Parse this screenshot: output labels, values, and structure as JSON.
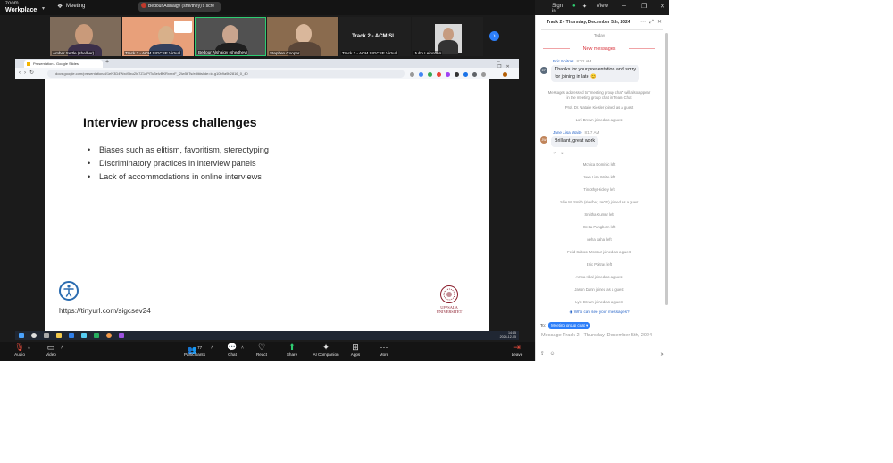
{
  "app": {
    "brand_line1": "zoom",
    "brand_line2": "Workplace",
    "meeting_label": "Meeting",
    "speaking_now": "Bedour Alshaigy (she/they)'s scre",
    "sign_in": "Sign in",
    "view_label": "View"
  },
  "participants": [
    {
      "name": "Amber Settle (she/her)"
    },
    {
      "name": "Track 2 - ACM SIGCSE Virtual"
    },
    {
      "name": "Bedour Alshaigy (she/they)"
    },
    {
      "name": "Stephen Cooper"
    },
    {
      "name": "Track 2 - ACM SIGCSE Virtual",
      "center_label": "Track 2 - ACM SI..."
    },
    {
      "name": "Juho Leinonen"
    }
  ],
  "browser": {
    "tab_title": "Presentation - Google Slides",
    "url": "docs.google.com/presentation/d/1eN3D4Wxd9lxu2ln7Z1oPlTu3elvBXRxmxF_l2lw5bTs/edit#slide=id.g10b9a9b2816_0_40"
  },
  "slide": {
    "title": "Interview process challenges",
    "bullets": [
      "Biases such as elitism, favoritism, stereotyping",
      "Discriminatory practices in interview panels",
      "Lack of accommodations in online interviews"
    ],
    "link": "https://tinyurl.com/sigcsev24",
    "logo_line1": "UPPSALA",
    "logo_line2": "UNIVERSITET"
  },
  "taskbar": {
    "time": "14:45",
    "date": "2024-12-05"
  },
  "toolbar": {
    "audio": "Audio",
    "video": "Video",
    "participants": "Participants",
    "participants_count": "77",
    "chat": "Chat",
    "react": "React",
    "share": "Share",
    "ai_companion": "AI Companion",
    "apps": "Apps",
    "more": "More",
    "leave": "Leave"
  },
  "chat": {
    "title": "Track 2 - Thursday, December 5th, 2024",
    "today": "Today",
    "new_messages": "New messages",
    "messages": [
      {
        "sender": "Eric Poitras",
        "time": "8:02 AM",
        "text_line1": "Thanks for your presentation and sorry",
        "text_line2": "for joining in late 😊",
        "initials": "EP"
      },
      {
        "sender": "Jane Lisa Waite",
        "time": "8:17 AM",
        "text": "Brilliant, great work",
        "initials": "JW"
      }
    ],
    "notice_line1": "Messages addressed to \"meeting group chat\" will also appear",
    "notice_line2": "in the meeting group chat in Team Chat",
    "events_a": [
      "Prof. Dr. Natalie Kiesler joined as a guest",
      "Lori Brown joined as a guest"
    ],
    "events_b": [
      "Monica Dominic left",
      "Jane Lisa Waite left",
      "Timothy Hickey left",
      "Julie M. Smith (she/her, IACE) joined as a guest",
      "Smitha Kumar left",
      "Greta Pangborn left",
      "neha sahai left",
      "Felid Saboor Monsur joined as a guest",
      "Eric Poitras left",
      "Asma Hilal joined as a guest",
      "Jason Dunn joined as a guest",
      "Lyle Brown joined as a guest"
    ],
    "who_can_see": "Who can see your messages?",
    "to_label": "To:",
    "to_recipient": "Meeting group chat",
    "compose_placeholder": "Message Track 2 - Thursday, December 5th, 2024"
  }
}
